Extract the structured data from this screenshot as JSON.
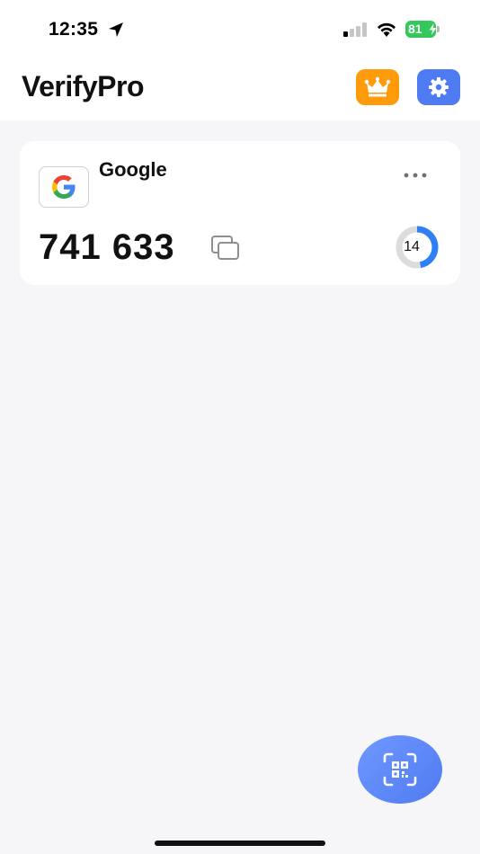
{
  "status_bar": {
    "time": "12:35",
    "battery_level": "81",
    "icons": [
      "location-arrow-icon",
      "cellular-signal-icon",
      "wifi-icon",
      "battery-icon"
    ]
  },
  "header": {
    "title": "VerifyPro",
    "premium_icon": "crown-icon",
    "settings_icon": "gear-icon"
  },
  "accounts": [
    {
      "name": "Google",
      "code": "741 633",
      "seconds_remaining": "14",
      "timer_fraction": 0.47,
      "icon": "google-logo"
    }
  ],
  "fab": {
    "icon": "qr-scan-icon"
  },
  "colors": {
    "premium": "#ff9a0a",
    "settings": "#4f7bf2",
    "timer": "#2f7ff5",
    "battery": "#34c759"
  }
}
